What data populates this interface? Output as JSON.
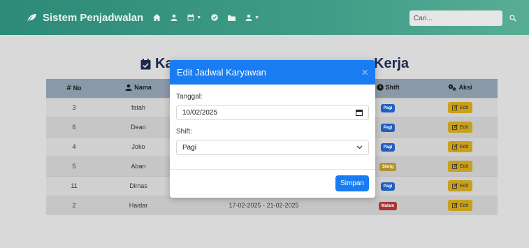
{
  "navbar": {
    "brand": "Sistem Penjadwalan",
    "search_placeholder": "Cari..."
  },
  "page": {
    "title_left": "Ka",
    "title_right": "Kerja"
  },
  "table": {
    "headers": {
      "no": "No",
      "nama": "Nama",
      "tanggal": "",
      "shift": "Shift",
      "aksi": "Aksi"
    },
    "rows": [
      {
        "no": "3",
        "nama": "fatah",
        "tanggal": "",
        "shift": "Pagi",
        "aksi": "Edit"
      },
      {
        "no": "6",
        "nama": "Dean",
        "tanggal": "",
        "shift": "Pagi",
        "aksi": "Edit"
      },
      {
        "no": "4",
        "nama": "Joko",
        "tanggal": "",
        "shift": "Pagi",
        "aksi": "Edit"
      },
      {
        "no": "5",
        "nama": "Aban",
        "tanggal": "",
        "shift": "Siang",
        "aksi": "Edit"
      },
      {
        "no": "11",
        "nama": "Dimas",
        "tanggal": "",
        "shift": "Pagi",
        "aksi": "Edit"
      },
      {
        "no": "2",
        "nama": "Haidar",
        "tanggal": "17-02-2025 - 21-02-2025",
        "shift": "Malam",
        "aksi": "Edit"
      }
    ]
  },
  "modal": {
    "title": "Edit Jadwal Karyawan",
    "close": "×",
    "tanggal_label": "Tanggal:",
    "tanggal_value": "10/02/2025",
    "shift_label": "Shift:",
    "shift_value": "Pagi",
    "submit": "Simpan"
  },
  "colors": {
    "navbar": "#3f9c86",
    "modal_header": "#1a7cf2",
    "badge_pagi": "#1f5fc0",
    "badge_siang": "#b6902a",
    "badge_malam": "#a83434",
    "edit_button": "#c8a01a"
  }
}
